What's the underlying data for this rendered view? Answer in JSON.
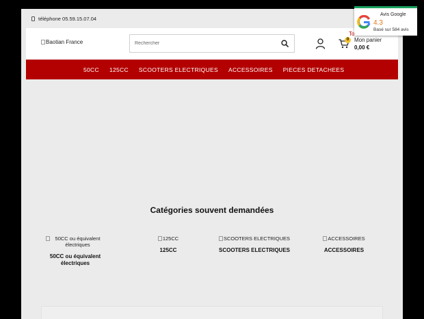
{
  "topbar": {
    "phone_label": "téléphone 05.59.15.07.04"
  },
  "header": {
    "logo_alt": "Baotian France",
    "search_placeholder": "Rechercher",
    "cart_count": "0",
    "cart_label": "Mon panier",
    "cart_total": "0,00 €",
    "cut_text": "Tou"
  },
  "nav": {
    "items": [
      "50CC",
      "125CC",
      "SCOOTERS ELECTRIQUES",
      "ACCESSOIRES",
      "PIECES DETACHEES"
    ]
  },
  "categories": {
    "title": "Catégories souvent demandées",
    "items": [
      {
        "alt": "50CC ou équivalent électriques",
        "title": "50CC ou équivalent électriques"
      },
      {
        "alt": "125CC",
        "title": "125CC"
      },
      {
        "alt": "SCOOTERS ELECTRIQUES",
        "title": "SCOOTERS ELECTRIQUES"
      },
      {
        "alt": "ACCESSOIRES",
        "title": "ACCESSOIRES"
      }
    ]
  },
  "reviews": {
    "title": "Avis Google",
    "score": "4.3",
    "based_on": "Basé sur 584 avis"
  },
  "colors": {
    "nav_bg": "#b30000",
    "badge": "#f1c232",
    "score": "#e0761c",
    "accent_green": "#1aa260"
  },
  "icons": [
    "phone-icon",
    "search-icon",
    "user-icon",
    "cart-icon",
    "google-logo-icon"
  ]
}
